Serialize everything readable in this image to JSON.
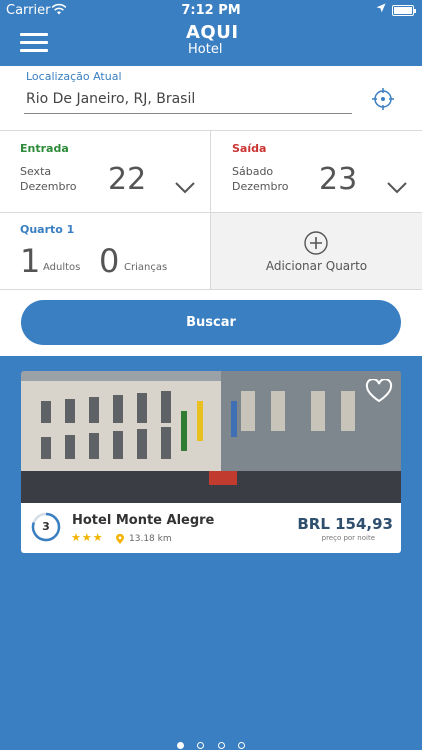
{
  "status": {
    "carrier": "Carrier",
    "time": "7:12 PM"
  },
  "header": {
    "logo_top": "AQUI",
    "logo_bottom": "Hotel"
  },
  "location": {
    "label": "Localização Atual",
    "value": "Rio De Janeiro, RJ, Brasil"
  },
  "checkin": {
    "label": "Entrada",
    "weekday": "Sexta",
    "month": "Dezembro",
    "day": "22"
  },
  "checkout": {
    "label": "Saída",
    "weekday": "Sábado",
    "month": "Dezembro",
    "day": "23"
  },
  "room": {
    "label": "Quarto 1",
    "adults": "1",
    "adults_label": "Adultos",
    "children": "0",
    "children_label": "Crianças"
  },
  "add_room": {
    "label": "Adicionar Quarto"
  },
  "search": {
    "label": "Buscar"
  },
  "hotel": {
    "rank": "3",
    "name": "Hotel Monte Alegre",
    "stars": "★★★",
    "star_count": 3,
    "distance": "13.18 km",
    "price": "BRL 154,93",
    "price_note": "preço por noite"
  },
  "pager": {
    "total": 4,
    "active": 1
  },
  "colors": {
    "primary": "#3a7fc1",
    "checkin": "#2e8b3a",
    "checkout": "#cc3333",
    "star": "#f3b400"
  }
}
